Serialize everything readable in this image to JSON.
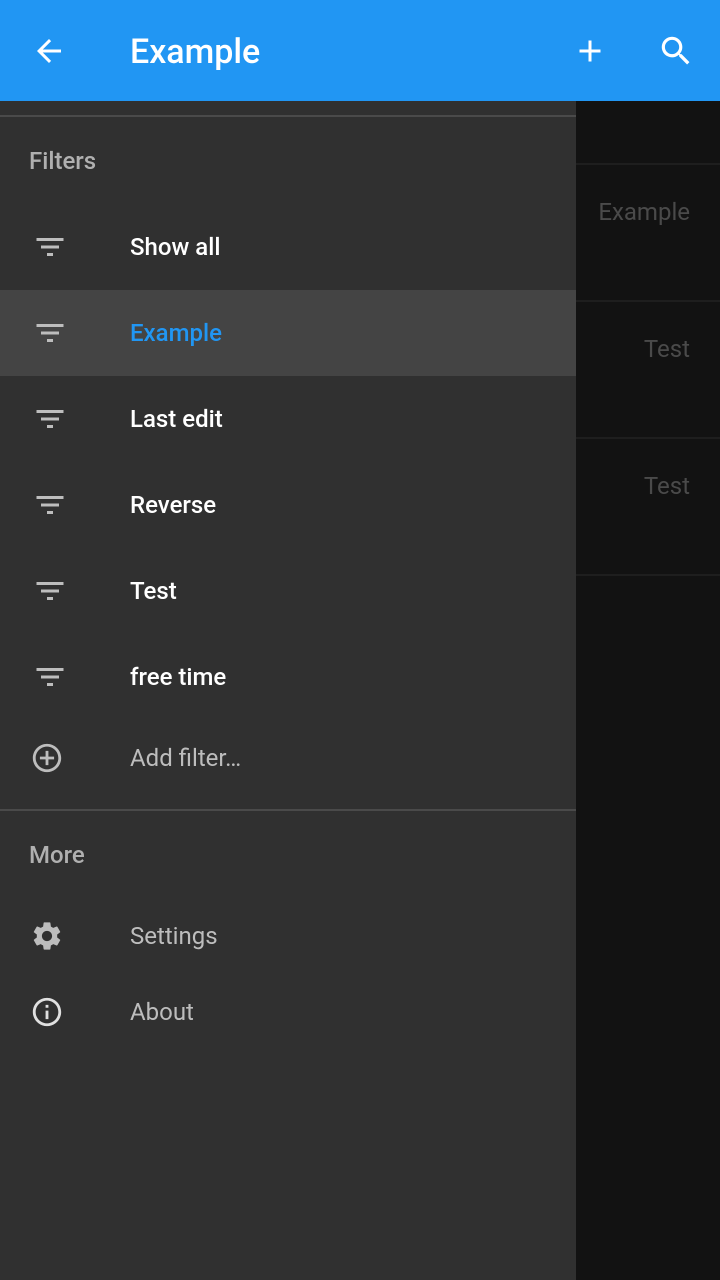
{
  "appbar": {
    "title": "Example",
    "back_icon": "arrow-back-icon",
    "add_icon": "plus-icon",
    "search_icon": "search-icon",
    "color": "#2196F3"
  },
  "background_list": {
    "items": [
      "Example",
      "Test",
      "Test"
    ]
  },
  "drawer": {
    "filters_header": "Filters",
    "filters": [
      {
        "label": "Show all",
        "icon": "filter-icon",
        "active": false
      },
      {
        "label": "Example",
        "icon": "filter-icon",
        "active": true
      },
      {
        "label": "Last edit",
        "icon": "filter-icon",
        "active": false
      },
      {
        "label": "Reverse",
        "icon": "filter-icon",
        "active": false
      },
      {
        "label": "Test",
        "icon": "filter-icon",
        "active": false
      },
      {
        "label": "free time",
        "icon": "filter-icon",
        "active": false
      }
    ],
    "add_filter": {
      "label": "Add filter…",
      "icon": "add-circle-icon"
    },
    "more_header": "More",
    "more": [
      {
        "label": "Settings",
        "icon": "gear-icon"
      },
      {
        "label": "About",
        "icon": "info-icon"
      }
    ],
    "accent_color": "#2196F3"
  }
}
